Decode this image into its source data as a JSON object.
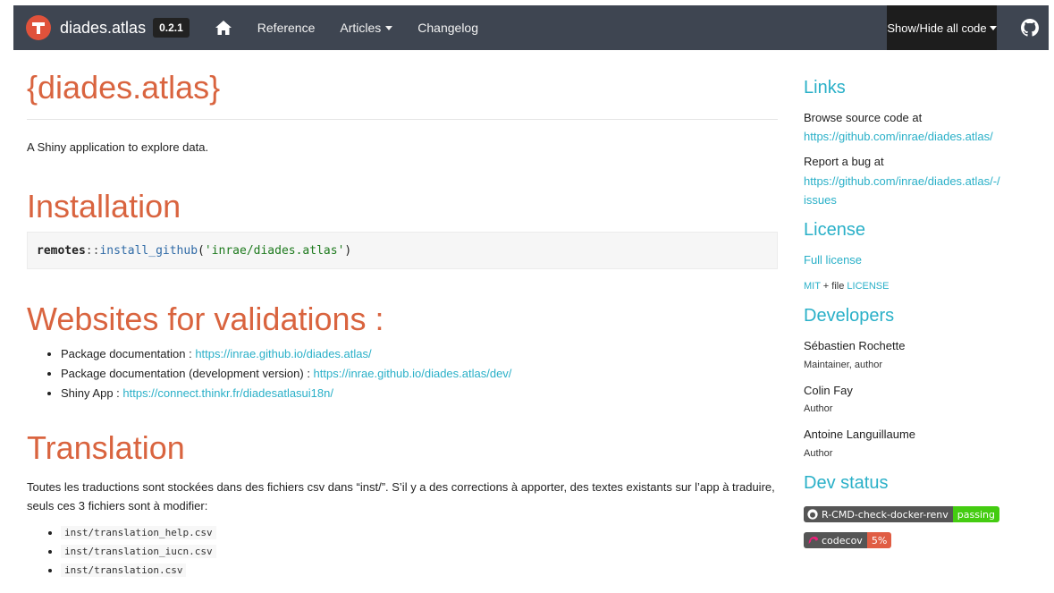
{
  "navbar": {
    "brand": "diades.atlas",
    "version": "0.2.1",
    "links": [
      "Reference",
      "Articles",
      "Changelog"
    ],
    "code_toggle": "Show/Hide all code",
    "icons": [
      "home-icon",
      "github-icon",
      "logo-icon"
    ]
  },
  "main": {
    "title": "{diades.atlas}",
    "description": "A Shiny application to explore data.",
    "installation": {
      "heading": "Installation",
      "code_ns": "remotes",
      "code_op": "::",
      "code_fn": "install_github",
      "code_open": "(",
      "code_str": "'inrae/diades.atlas'",
      "code_close": ")"
    },
    "validation": {
      "heading": "Websites for validations :",
      "items": [
        {
          "label": "Package documentation : ",
          "url": "https://inrae.github.io/diades.atlas/"
        },
        {
          "label": "Package documentation (development version) : ",
          "url": "https://inrae.github.io/diades.atlas/dev/"
        },
        {
          "label": "Shiny App : ",
          "url": "https://connect.thinkr.fr/diadesatlasui18n/"
        }
      ]
    },
    "translation": {
      "heading": "Translation",
      "paragraph": "Toutes les traductions sont stockées dans des fichiers csv dans “inst/”. S’il y a des corrections à apporter, des textes existants sur l’app à traduire, seuls ces 3 fichiers sont à modifier:",
      "files": [
        "inst/translation_help.csv",
        "inst/translation_iucn.csv",
        "inst/translation.csv"
      ]
    }
  },
  "sidebar": {
    "links": {
      "heading": "Links",
      "browse_label": "Browse source code at",
      "browse_url": "https://github.com/inrae/diades.atlas/",
      "bug_label": "Report a bug at",
      "bug_url_1": "https://github.com/inrae/diades.atlas/-/",
      "bug_url_2": "issues"
    },
    "license": {
      "heading": "License",
      "full": "Full license",
      "mit": "MIT",
      "plus_file": " + file ",
      "file": "LICENSE"
    },
    "developers": {
      "heading": "Developers",
      "people": [
        {
          "name": "Sébastien Rochette",
          "role": "Maintainer, author"
        },
        {
          "name": "Colin Fay",
          "role": "Author"
        },
        {
          "name": "Antoine Languillaume",
          "role": "Author"
        }
      ]
    },
    "dev_status": {
      "heading": "Dev status",
      "badge1_label": "R-CMD-check-docker-renv",
      "badge1_status": "passing",
      "badge2_label": "codecov",
      "badge2_status": "5%"
    }
  },
  "colors": {
    "navbar_bg": "#3e4551",
    "heading": "#d9643f",
    "link": "#2ab0c8",
    "passing": "#4c1",
    "codecov": "#e05d44"
  }
}
